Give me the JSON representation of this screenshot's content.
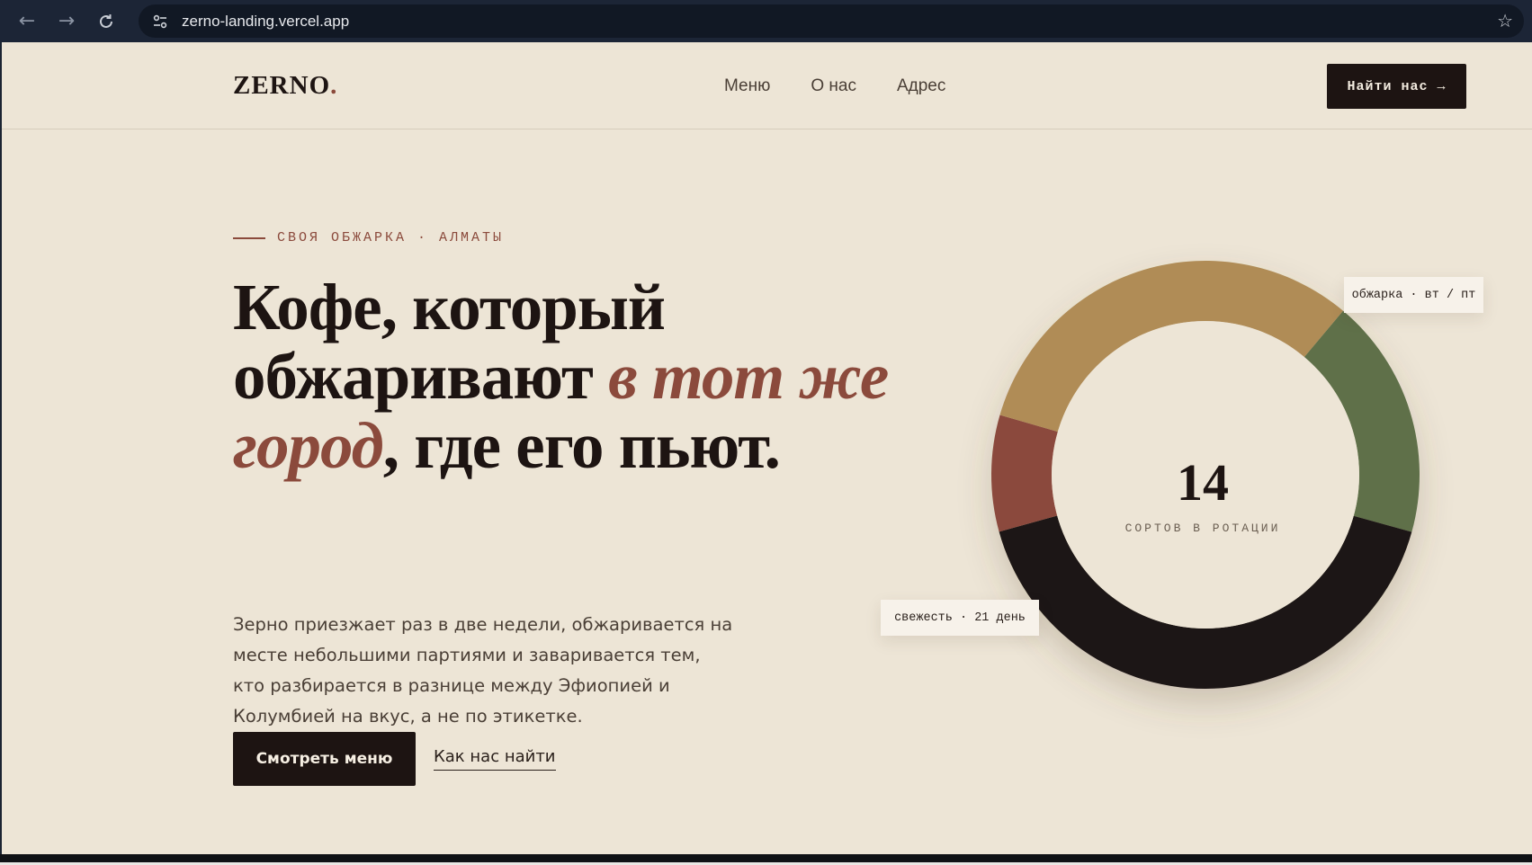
{
  "browser": {
    "url": "zerno-landing.vercel.app",
    "icons": [
      "arrow-left-icon",
      "arrow-right-icon",
      "reload-icon",
      "site-info-icon",
      "star-icon"
    ]
  },
  "header": {
    "logo": "ZERNO",
    "logo_dot": ".",
    "nav": [
      "Меню",
      "О нас",
      "Адрес"
    ],
    "cta": "Найти нас →"
  },
  "hero": {
    "eyebrow": "СВОЯ ОБЖАРКА · АЛМАТЫ",
    "headline_part1": "Кофе, который обжаривают ",
    "headline_accent": "в тот же город",
    "headline_part2": ", где его пьют.",
    "lead": "Зерно приезжает раз в две недели, обжаривается на месте небольшими партиями и заваривается тем, кто разбирается в разнице между Эфиопией и Колумбией на вкус, а не по этикетке.",
    "primary_button": "Смотреть меню",
    "secondary_link": "Как нас найти"
  },
  "stat": {
    "value": "14",
    "label": "СОРТОВ В РОТАЦИИ",
    "tag_roast": "обжарка · вт / пт",
    "tag_fresh": "свежесть · 21 день",
    "ring_segments": [
      {
        "fraction": 0.182,
        "color": "#5e7049"
      },
      {
        "fraction": 0.414,
        "color": "#1d1412"
      },
      {
        "fraction": 0.088,
        "color": "#8b4a3c"
      },
      {
        "fraction": 0.316,
        "color": "#b08c57"
      }
    ]
  },
  "colors": {
    "background": "#ede5d6",
    "ink": "#1d1412",
    "accent": "#8b4a3c"
  }
}
